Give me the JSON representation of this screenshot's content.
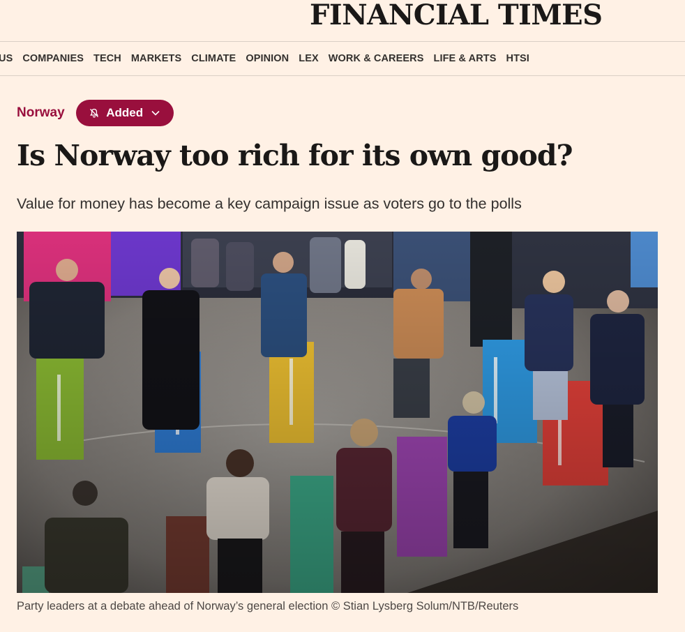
{
  "masthead": {
    "title": "FINANCIAL TIMES"
  },
  "nav": {
    "items": [
      "US",
      "COMPANIES",
      "TECH",
      "MARKETS",
      "CLIMATE",
      "OPINION",
      "LEX",
      "WORK & CAREERS",
      "LIFE & ARTS",
      "HTSI"
    ]
  },
  "article": {
    "topic": "Norway",
    "follow_label": "Added",
    "headline": "Is Norway too rich for its own good?",
    "standfirst": "Value for money has become a key campaign issue as voters go to the polls",
    "caption": "Party leaders at a debate ahead of Norway’s general election © Stian Lysberg Solum/NTB/Reuters"
  },
  "colors": {
    "background": "#fff1e5",
    "accent": "#990f3d",
    "text": "#33302e"
  },
  "icons": {
    "follow_bell": "bell-off-icon",
    "follow_chevron": "chevron-down-icon"
  }
}
